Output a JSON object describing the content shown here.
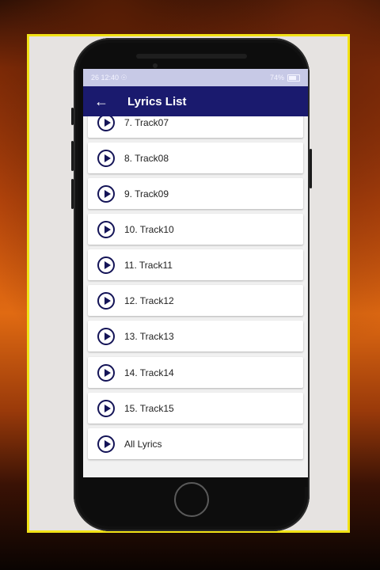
{
  "status_bar": {
    "time": "26 12:40 ☉",
    "battery": "74%"
  },
  "app_bar": {
    "title": "Lyrics List",
    "back_icon": "arrow-left-icon"
  },
  "tracks": [
    {
      "label": "7. Track07"
    },
    {
      "label": "8. Track08"
    },
    {
      "label": "9. Track09"
    },
    {
      "label": "10. Track10"
    },
    {
      "label": "11. Track11"
    },
    {
      "label": "12. Track12"
    },
    {
      "label": "13. Track13"
    },
    {
      "label": "14. Track14"
    },
    {
      "label": "15. Track15"
    },
    {
      "label": "All Lyrics"
    }
  ],
  "colors": {
    "app_bar": "#1a1a6e",
    "play_icon": "#141457",
    "frame_border": "#f2e216"
  }
}
